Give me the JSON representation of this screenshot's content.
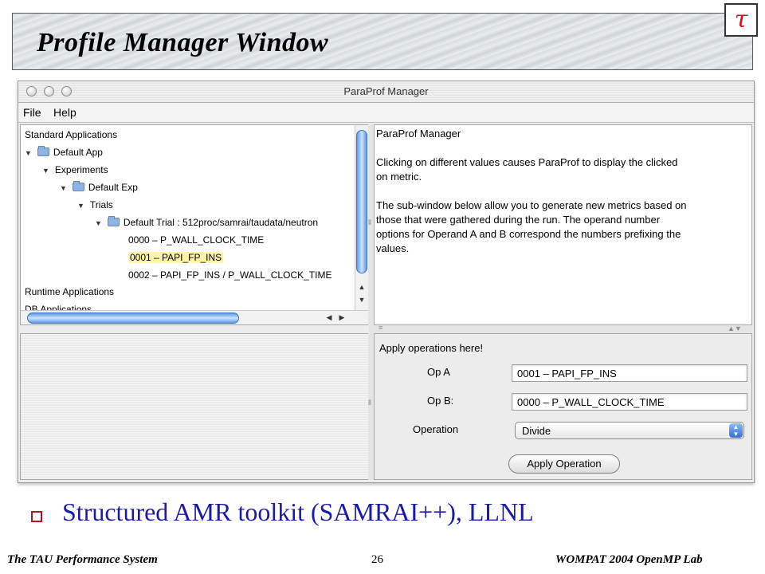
{
  "slide": {
    "title": "Profile Manager Window",
    "logo_glyph": "τ",
    "bullet": "Structured AMR toolkit (SAMRAI++), LLNL",
    "footer_left": "The TAU Performance System",
    "page_number": "26",
    "footer_right": "WOMPAT 2004 OpenMP Lab"
  },
  "window": {
    "title": "ParaProf Manager",
    "menu": [
      "File",
      "Help"
    ]
  },
  "tree": {
    "items": [
      {
        "label": "Standard Applications"
      },
      {
        "label": "Default App"
      },
      {
        "label": "Experiments"
      },
      {
        "label": "Default Exp"
      },
      {
        "label": "Trials"
      },
      {
        "label": "Default Trial : 512proc/samrai/taudata/neutron"
      },
      {
        "label": "0000 – P_WALL_CLOCK_TIME"
      },
      {
        "label": "0001 – PAPI_FP_INS"
      },
      {
        "label": "0002 – PAPI_FP_INS / P_WALL_CLOCK_TIME"
      },
      {
        "label": "Runtime Applications"
      },
      {
        "label": "DB Applications"
      }
    ],
    "selected_index": 7
  },
  "info": {
    "heading": "ParaProf Manager",
    "para1_line1": "Clicking on different values causes ParaProf to display the clicked",
    "para1_line2": "on metric.",
    "para2_line1": "The sub-window below allow you to generate new metrics based on",
    "para2_line2": "those that were gathered during the run.  The operand number",
    "para2_line3": "options for Operand A and B correspond the numbers prefixing the",
    "para2_line4": "values."
  },
  "operations": {
    "heading": "Apply operations here!",
    "op_a_label": "Op A",
    "op_a_value": "0001 – PAPI_FP_INS",
    "op_b_label": "Op B:",
    "op_b_value": "0000 – P_WALL_CLOCK_TIME",
    "operation_label": "Operation",
    "operation_value": "Divide",
    "apply_button": "Apply Operation"
  },
  "colors": {
    "highlight": "#fff5a8",
    "bullet_text": "#1a1aa8",
    "logo_red": "#d0101a"
  }
}
